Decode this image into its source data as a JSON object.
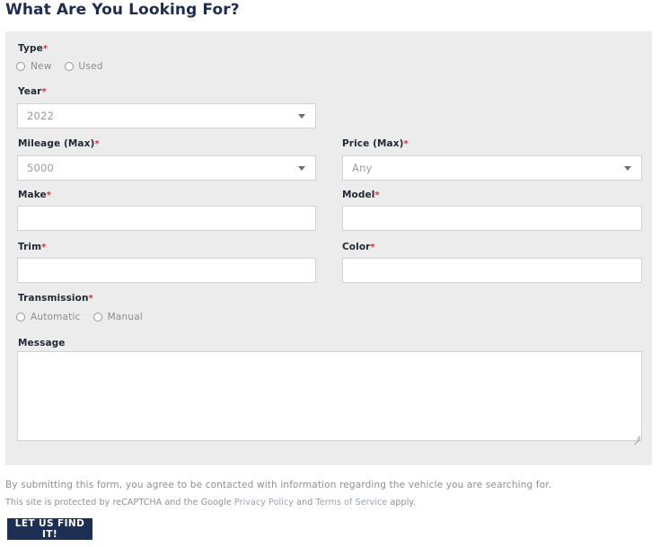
{
  "page": {
    "title": "What Are You Looking For?"
  },
  "form": {
    "type": {
      "label": "Type",
      "required": "*",
      "options": [
        {
          "label": "New",
          "selected": false
        },
        {
          "label": "Used",
          "selected": false
        }
      ]
    },
    "year": {
      "label": "Year",
      "required": "*",
      "value": "2022",
      "caret": "chevron-down-icon"
    },
    "mileage_max": {
      "label": "Mileage (Max)",
      "required": "*",
      "value": "5000",
      "caret": "chevron-down-icon"
    },
    "price_max": {
      "label": "Price (Max)",
      "required": "*",
      "value": "Any",
      "caret": "chevron-down-icon"
    },
    "make": {
      "label": "Make",
      "required": "*",
      "value": "",
      "placeholder": ""
    },
    "model": {
      "label": "Model",
      "required": "*",
      "value": "",
      "placeholder": ""
    },
    "trim": {
      "label": "Trim",
      "required": "*",
      "value": "",
      "placeholder": ""
    },
    "color": {
      "label": "Color",
      "required": "*",
      "value": "",
      "placeholder": ""
    },
    "transmission": {
      "label": "Transmission",
      "required": "*",
      "options": [
        {
          "label": "Automatic",
          "selected": false
        },
        {
          "label": "Manual",
          "selected": false
        }
      ]
    },
    "message": {
      "label": "Message",
      "required": "",
      "value": "",
      "placeholder": ""
    }
  },
  "footer": {
    "disclaimer": "By submitting this form, you agree to be contacted with information regarding the vehicle you are searching for.",
    "recaptcha_prefix": "This site is protected by reCAPTCHA and the Google ",
    "privacy_policy": "Privacy Policy",
    "recaptcha_middle": " and ",
    "terms_of_service": "Terms of Service",
    "recaptcha_suffix": " apply.",
    "submit_label": "LET US FIND IT!"
  },
  "colors": {
    "title": "#1d2d50",
    "panel_bg": "#ececec",
    "required_asterisk": "#d63030",
    "button_bg": "#1d3054",
    "field_border": "#d2d2d2"
  }
}
